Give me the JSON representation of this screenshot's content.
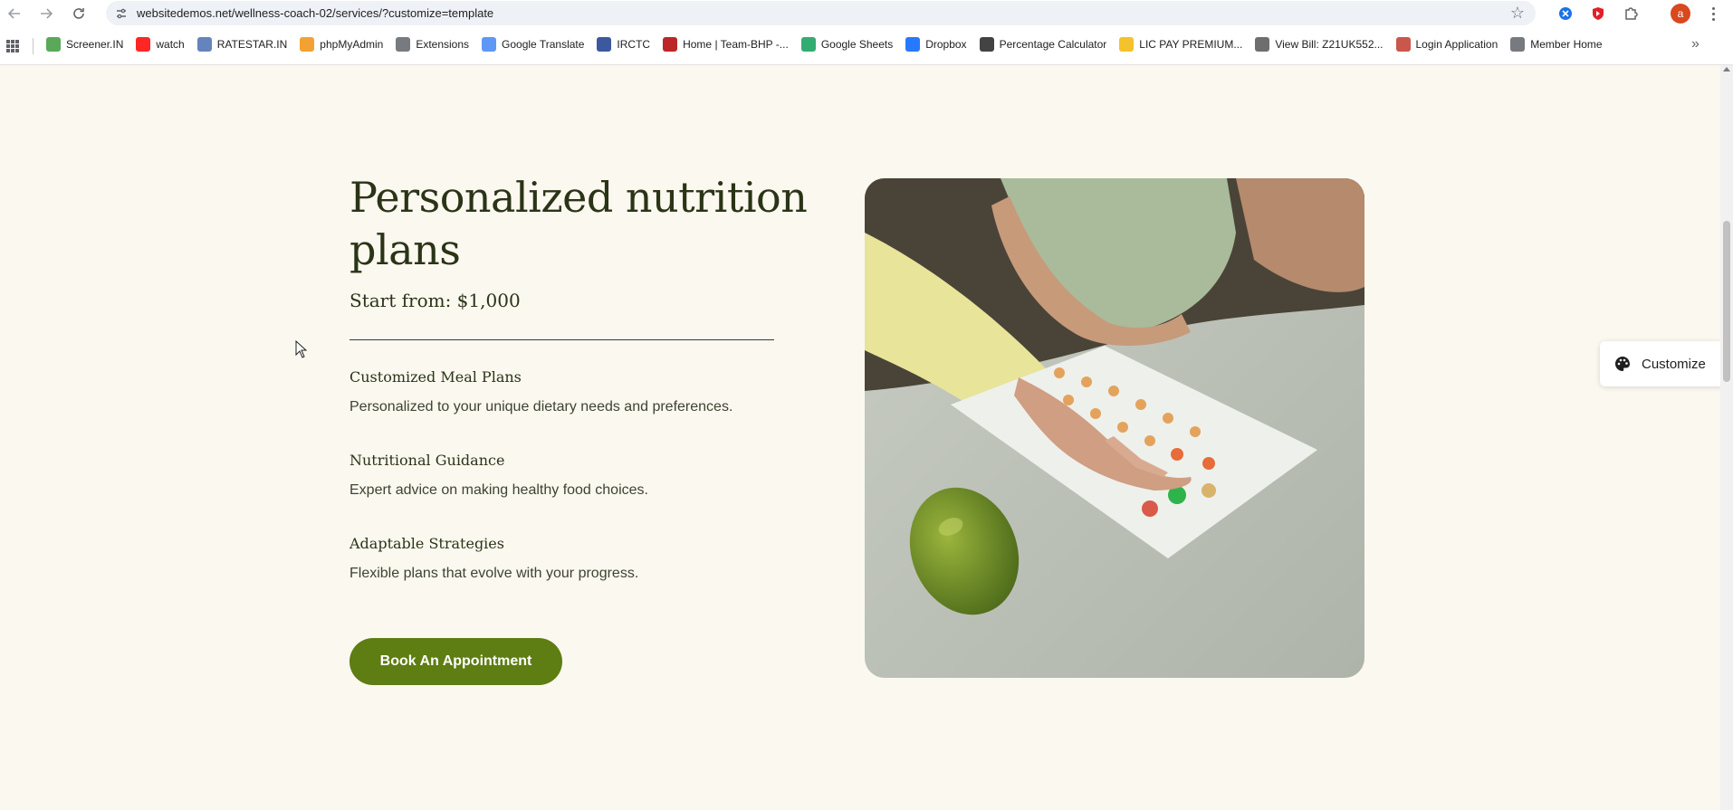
{
  "browser": {
    "url": "websitedemos.net/wellness-coach-02/services/?customize=template",
    "profile_initial": "a"
  },
  "bookmarks": [
    {
      "label": "Screener.IN",
      "icon": "bar-chart-icon",
      "color": "#3d9a3d"
    },
    {
      "label": "watch",
      "icon": "youtube-icon",
      "color": "#ff0000"
    },
    {
      "label": "RATESTAR.IN",
      "icon": "ratestar-icon",
      "color": "#4a6fb3"
    },
    {
      "label": "phpMyAdmin",
      "icon": "phpmyadmin-icon",
      "color": "#f29111"
    },
    {
      "label": "Extensions",
      "icon": "puzzle-icon",
      "color": "#5f6368"
    },
    {
      "label": "Google Translate",
      "icon": "translate-icon",
      "color": "#4285f4"
    },
    {
      "label": "IRCTC",
      "icon": "irctc-icon",
      "color": "#1a3c8c"
    },
    {
      "label": "Home | Team-BHP -...",
      "icon": "team-bhp-icon",
      "color": "#b00000"
    },
    {
      "label": "Google Sheets",
      "icon": "sheets-icon",
      "color": "#0f9d58"
    },
    {
      "label": "Dropbox",
      "icon": "dropbox-icon",
      "color": "#0061ff"
    },
    {
      "label": "Percentage Calculator",
      "icon": "percent-icon",
      "color": "#222222"
    },
    {
      "label": "LIC PAY PREMIUM...",
      "icon": "lic-icon",
      "color": "#f2b705"
    },
    {
      "label": "View Bill: Z21UK552...",
      "icon": "bill-icon",
      "color": "#555555"
    },
    {
      "label": "Login Application",
      "icon": "login-icon",
      "color": "#c0392b"
    },
    {
      "label": "Member Home",
      "icon": "globe-icon",
      "color": "#5f6368"
    }
  ],
  "service": {
    "title": "Personalized nutrition plans",
    "price": "Start from: $1,000",
    "features": [
      {
        "title": "Customized Meal Plans",
        "desc": "Personalized to your unique dietary needs and preferences."
      },
      {
        "title": "Nutritional Guidance",
        "desc": "Expert advice on making healthy food choices."
      },
      {
        "title": "Adaptable Strategies",
        "desc": "Flexible plans that evolve with your progress."
      }
    ],
    "cta": "Book An Appointment"
  },
  "customize": {
    "label": "Customize"
  },
  "colors": {
    "page_bg": "#fbf8f0",
    "heading": "#2a3416",
    "button": "#5e7d12"
  }
}
